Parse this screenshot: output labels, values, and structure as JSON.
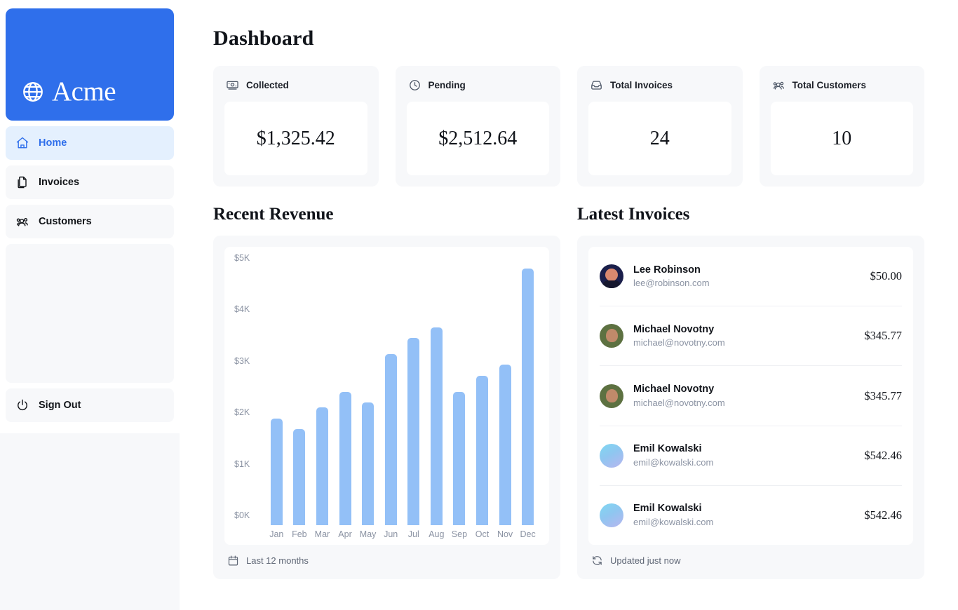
{
  "sidebar": {
    "logo": {
      "text": "Acme",
      "icon": "globe-icon",
      "bg": "#2f6feb"
    },
    "items": [
      {
        "label": "Home",
        "icon": "home-icon",
        "active": true
      },
      {
        "label": "Invoices",
        "icon": "documents-icon",
        "active": false
      },
      {
        "label": "Customers",
        "icon": "users-icon",
        "active": false
      }
    ],
    "signout": {
      "label": "Sign Out",
      "icon": "power-icon"
    }
  },
  "page": {
    "title": "Dashboard"
  },
  "cards": [
    {
      "label": "Collected",
      "value": "$1,325.42",
      "icon": "banknote-icon"
    },
    {
      "label": "Pending",
      "value": "$2,512.64",
      "icon": "clock-icon"
    },
    {
      "label": "Total Invoices",
      "value": "24",
      "icon": "inbox-icon"
    },
    {
      "label": "Total Customers",
      "value": "10",
      "icon": "users-icon"
    }
  ],
  "revenue": {
    "title": "Recent Revenue",
    "footer": "Last 12 months",
    "footer_icon": "calendar-icon"
  },
  "invoices": {
    "title": "Latest Invoices",
    "footer": "Updated just now",
    "footer_icon": "refresh-icon",
    "rows": [
      {
        "name": "Lee Robinson",
        "email": "lee@robinson.com",
        "amount": "$50.00",
        "avatar": "av-lee"
      },
      {
        "name": "Michael Novotny",
        "email": "michael@novotny.com",
        "amount": "$345.77",
        "avatar": "av-michael"
      },
      {
        "name": "Michael Novotny",
        "email": "michael@novotny.com",
        "amount": "$345.77",
        "avatar": "av-michael"
      },
      {
        "name": "Emil Kowalski",
        "email": "emil@kowalski.com",
        "amount": "$542.46",
        "avatar": "av-emil"
      },
      {
        "name": "Emil Kowalski",
        "email": "emil@kowalski.com",
        "amount": "$542.46",
        "avatar": "av-emil"
      }
    ]
  },
  "chart_data": {
    "type": "bar",
    "title": "Recent Revenue",
    "xlabel": "",
    "ylabel": "",
    "categories": [
      "Jan",
      "Feb",
      "Mar",
      "Apr",
      "May",
      "Jun",
      "Jul",
      "Aug",
      "Sep",
      "Oct",
      "Nov",
      "Dec"
    ],
    "values": [
      2000,
      1800,
      2200,
      2500,
      2300,
      3200,
      3500,
      3700,
      2500,
      2800,
      3000,
      4800
    ],
    "y_ticks": [
      "$5K",
      "$4K",
      "$3K",
      "$2K",
      "$1K",
      "$0K"
    ],
    "ylim": [
      0,
      5000
    ],
    "grid": false,
    "legend": false,
    "bar_color": "#93c0f7"
  }
}
